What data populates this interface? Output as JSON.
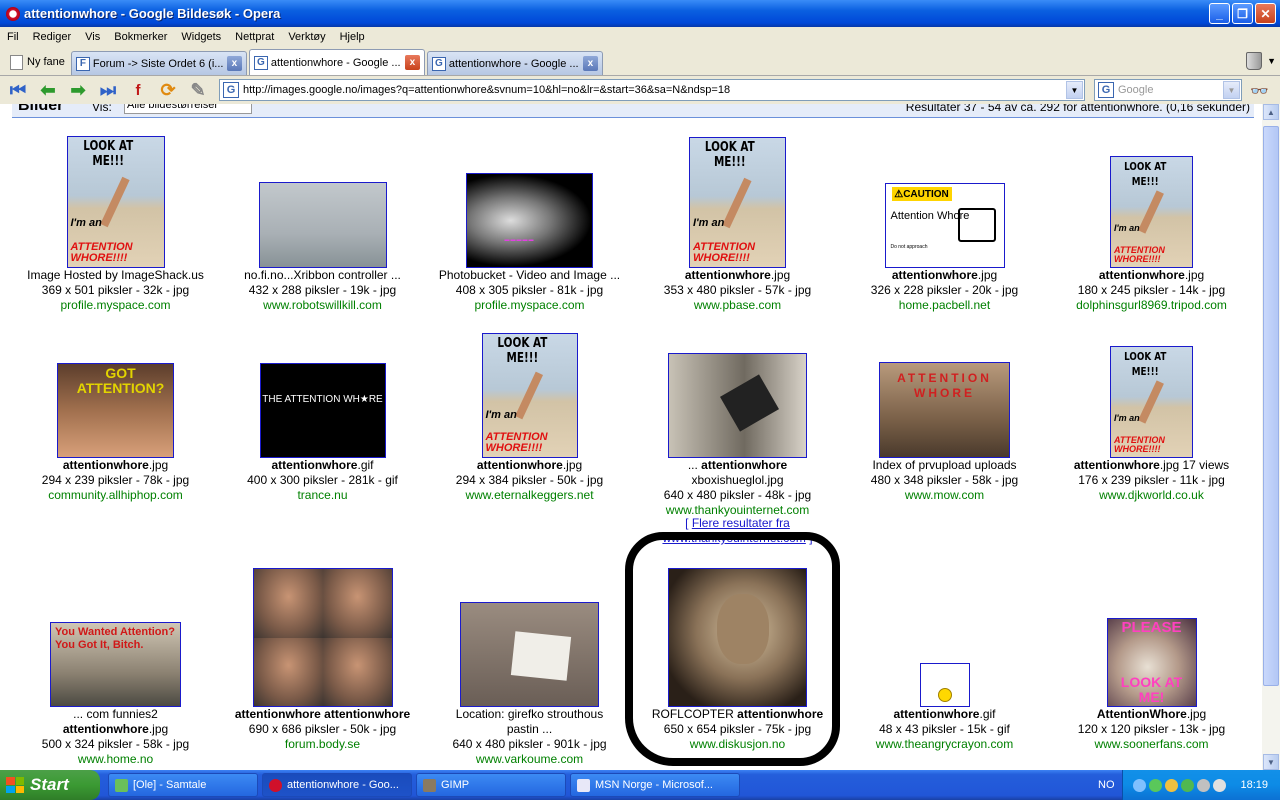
{
  "window": {
    "title": "attentionwhore - Google Bildesøk - Opera",
    "minimize_icon": "_",
    "maximize_icon": "❐",
    "close_icon": "✕"
  },
  "menu": [
    "Fil",
    "Rediger",
    "Vis",
    "Bokmerker",
    "Widgets",
    "Nettprat",
    "Verktøy",
    "Hjelp"
  ],
  "tabs": {
    "new_tab_label": "Ny fane",
    "items": [
      {
        "title": "Forum -> Siste Ordet 6 (i...",
        "favicon": "F",
        "close": "x"
      },
      {
        "title": "attentionwhore - Google ...",
        "favicon": "G",
        "close": "x"
      },
      {
        "title": "attentionwhore - Google ...",
        "favicon": "G",
        "close": "x"
      }
    ]
  },
  "toolbar": {
    "address": "http://images.google.no/images?q=attentionwhore&svnum=10&hl=no&lr=&start=36&sa=N&ndsp=18",
    "search_placeholder": "Google",
    "favicon": "G",
    "dropdown_glyph": "▼"
  },
  "results_bar": {
    "section": "Bilder",
    "show_label": "Vis:",
    "size_filter": "Alle bildestørrelser",
    "summary": "Resultater 37 - 54 av ca. 292 for attentionwhore. (0,16 sekunder)"
  },
  "results": [
    {
      "caption": "Image Hosted by ImageShack.us",
      "caption2": "",
      "size": "369 x 501 piksler - 32k - jpg",
      "site": "profile.myspace.com"
    },
    {
      "caption": "no.fi.no...Xribbon controller ...",
      "caption2": "",
      "size": "432 x 288 piksler - 19k - jpg",
      "site": "www.robotswillkill.com"
    },
    {
      "caption": "Photobucket - Video and Image ...",
      "caption2": "",
      "size": "408 x 305 piksler - 81k - jpg",
      "site": "profile.myspace.com"
    },
    {
      "caption_bold": "attentionwhore",
      "caption_rest": ".jpg",
      "size": "353 x 480 piksler - 57k - jpg",
      "site": "www.pbase.com"
    },
    {
      "caption_bold": "attentionwhore",
      "caption_rest": ".jpg",
      "size": "326 x 228 piksler - 20k - jpg",
      "site": "home.pacbell.net"
    },
    {
      "caption_bold": "attentionwhore",
      "caption_rest": ".jpg",
      "size": "180 x 245 piksler - 14k - jpg",
      "site": "dolphinsgurl8969.tripod.com"
    },
    {
      "caption_bold": "attentionwhore",
      "caption_rest": ".jpg",
      "size": "294 x 239 piksler - 78k - jpg",
      "site": "community.allhiphop.com"
    },
    {
      "caption_bold": "attentionwhore",
      "caption_rest": ".gif",
      "size": "400 x 300 piksler - 281k - gif",
      "site": "trance.nu"
    },
    {
      "caption_bold": "attentionwhore",
      "caption_rest": ".jpg",
      "size": "294 x 384 piksler - 50k - jpg",
      "site": "www.eternalkeggers.net"
    },
    {
      "caption_pre": "... ",
      "caption_bold": "attentionwhore",
      "caption2": "xboxishueglol.jpg",
      "size": "640 x 480 piksler - 48k - jpg",
      "site": "www.thankyouinternet.com"
    },
    {
      "caption": "Index of prvupload uploads",
      "size": "480 x 348 piksler - 58k - jpg",
      "site": "www.mow.com"
    },
    {
      "caption_bold": "attentionwhore",
      "caption_rest": ".jpg 17 views",
      "size": "176 x 239 piksler - 11k - jpg",
      "site": "www.djkworld.co.uk"
    },
    {
      "caption": "... com funnies2",
      "caption_bold": "attentionwhore",
      "caption_rest": ".jpg",
      "size": "500 x 324 piksler - 58k - jpg",
      "site": "www.home.no"
    },
    {
      "caption_bold": "attentionwhore attentionwhore",
      "size": "690 x 686 piksler - 50k - jpg",
      "site": "forum.body.se"
    },
    {
      "caption": "Location: girefko strouthous",
      "caption2": "pastin ...",
      "size": "640 x 480 piksler - 901k - jpg",
      "site": "www.varkoume.com"
    },
    {
      "caption": "ROFLCOPTER ",
      "caption_bold": "attentionwhore",
      "size": "650 x 654 piksler - 75k - jpg",
      "site": "www.diskusjon.no"
    },
    {
      "caption_bold": "attentionwhore",
      "caption_rest": ".gif",
      "size": "48 x 43 piksler - 15k - gif",
      "site": "www.theangrycrayon.com"
    },
    {
      "caption_bold": "AttentionWhore",
      "caption_rest": ".jpg",
      "size": "120 x 120 piksler - 13k - jpg",
      "site": "www.soonerfans.com"
    }
  ],
  "thumb_text": {
    "look_at_me": "LOOK AT ME!!!",
    "im_an": "I'm an",
    "attention_whore": "ATTENTION WHORE!!!!",
    "caution": "⚠CAUTION",
    "caution_text": "Attention Whore",
    "caution_sub": "Do not approach",
    "got_attention": "GOT ATTENTION?",
    "black_text": "THE ATTENTION WH★RE",
    "mow_text": "ATTENTION WHORE",
    "war_text": "You Wanted Attention? You Got It, Bitch.",
    "please": "PLEASE",
    "look_at_me_monkey": "LOOK AT ME!"
  },
  "more_results": {
    "open": "[ ",
    "link": "Flere resultater fra www.thankyouinternet.com",
    "close": " ]"
  },
  "taskbar": {
    "start": "Start",
    "items": [
      "[Ole] - Samtale",
      "attentionwhore - Goo...",
      "GIMP",
      "MSN Norge - Microsof..."
    ],
    "language": "NO",
    "clock": "18:19"
  }
}
